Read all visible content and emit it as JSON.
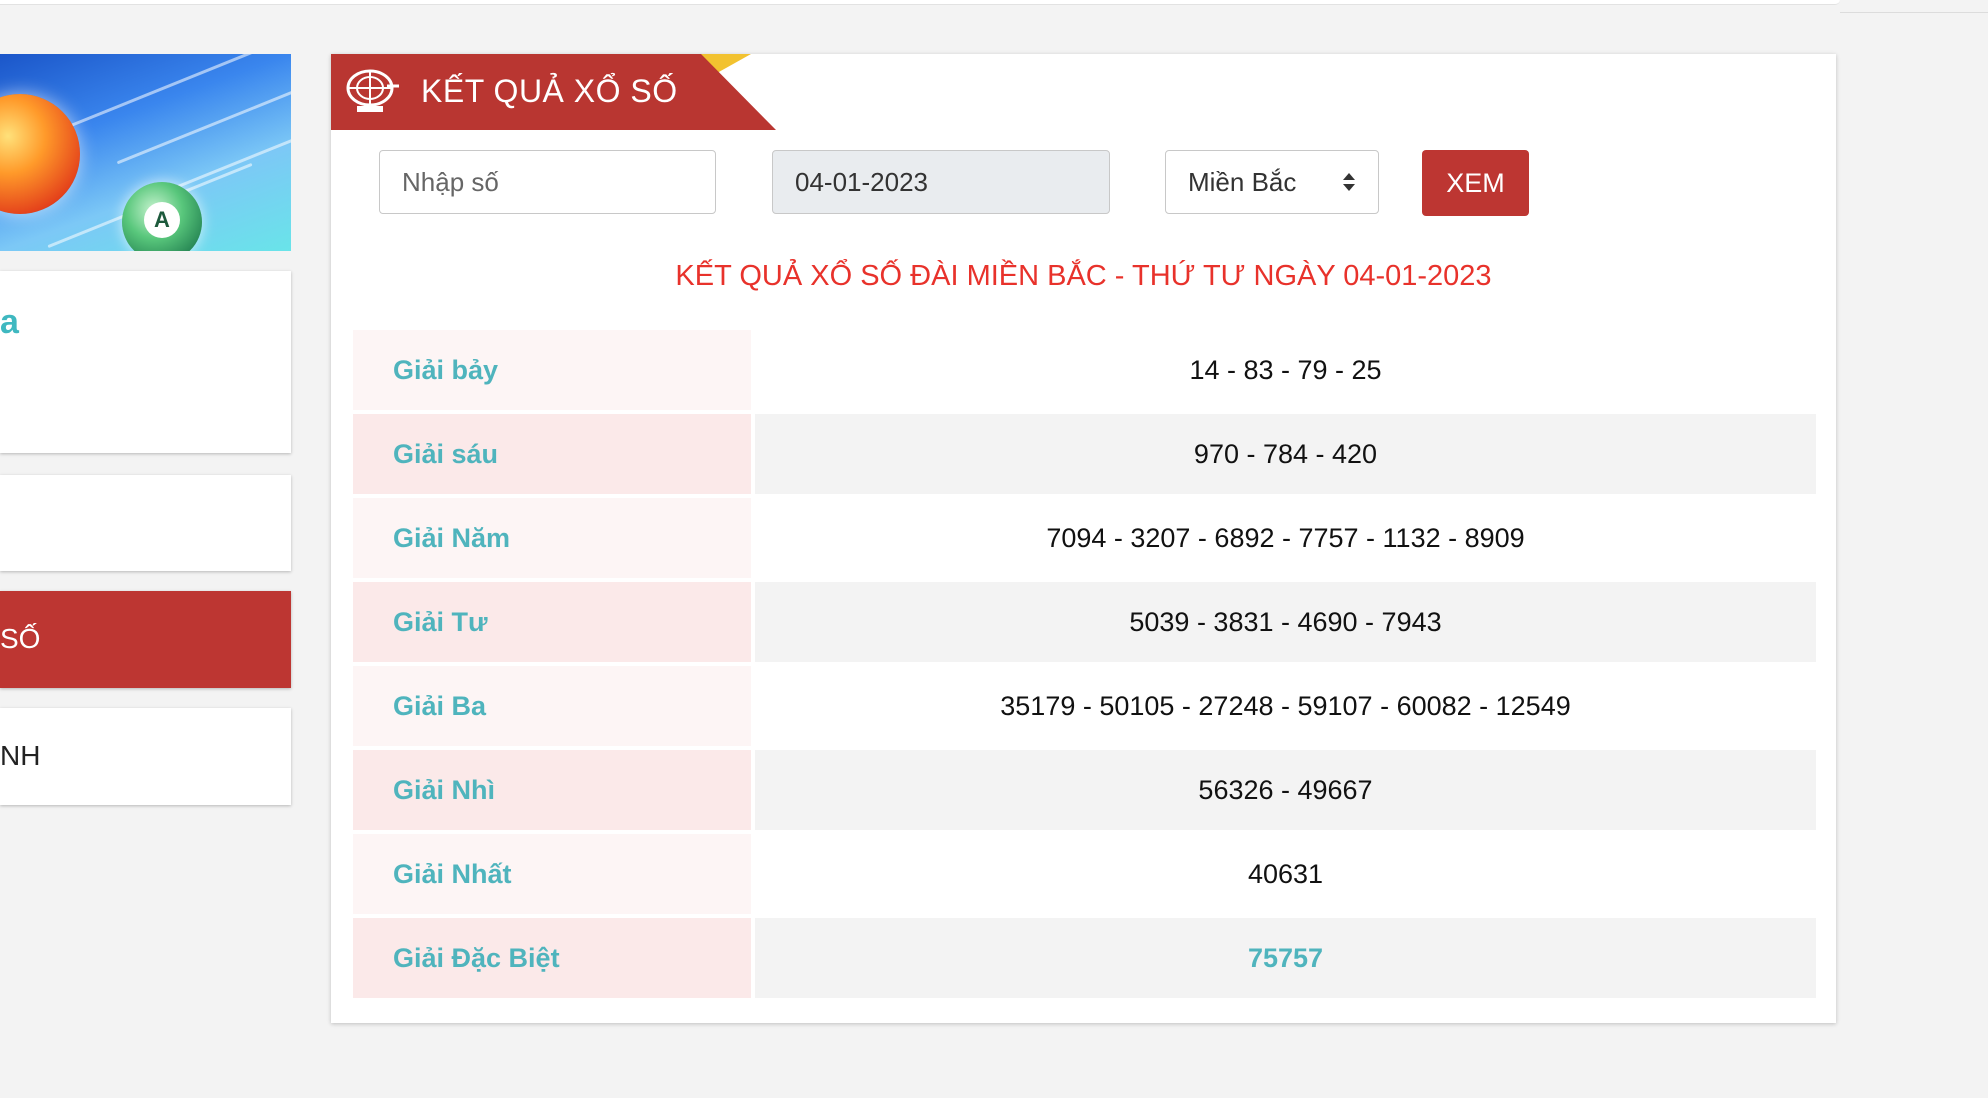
{
  "sidebar": {
    "card1_text": "a",
    "card3_label": "SỐ",
    "card4_label": "NH"
  },
  "panel": {
    "ribbon_title": "KẾT QUẢ XỔ SỐ",
    "filter": {
      "number_placeholder": "Nhập số",
      "date_value": "04-01-2023",
      "region_value": "Miền Bắc",
      "submit_label": "XEM"
    },
    "result_title": "KẾT QUẢ XỔ SỐ ĐÀI MIỀN BẮC - THỨ TƯ NGÀY 04-01-2023",
    "prizes": [
      {
        "label": "Giải bảy",
        "value": "14 - 83 - 79 - 25"
      },
      {
        "label": "Giải sáu",
        "value": "970 - 784 - 420"
      },
      {
        "label": "Giải Năm",
        "value": "7094 - 3207 - 6892 - 7757 - 1132 - 8909"
      },
      {
        "label": "Giải Tư",
        "value": "5039 - 3831 - 4690 - 7943"
      },
      {
        "label": "Giải Ba",
        "value": "35179 - 50105 - 27248 - 59107 - 60082 - 12549"
      },
      {
        "label": "Giải Nhì",
        "value": "56326 - 49667"
      },
      {
        "label": "Giải Nhất",
        "value": "40631"
      },
      {
        "label": "Giải Đặc Biệt",
        "value": "75757"
      }
    ]
  },
  "colors": {
    "brand_red": "#bd3632",
    "title_red": "#e8322b",
    "teal": "#4fb4bd",
    "ribbon_gold": "#f2c230"
  }
}
